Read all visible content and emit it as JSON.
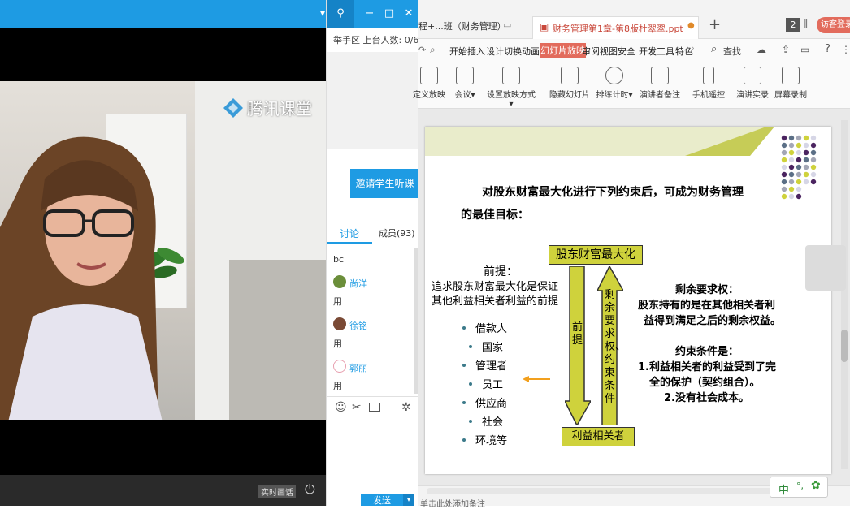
{
  "video": {
    "watermark": "腾讯课堂",
    "footer_label": "实时画话"
  },
  "side": {
    "hand_raise": "举手区 上台人数: 0/6",
    "invite_button": "邀请学生听课",
    "tabs": [
      "讨论",
      "成员(93)"
    ],
    "messages": [
      {
        "user": "",
        "text": "bc"
      },
      {
        "user": "尚洋",
        "text": "用"
      },
      {
        "user": "徐铭",
        "text": "用"
      },
      {
        "user": "郭丽",
        "text": "用"
      }
    ],
    "send_button": "发送"
  },
  "ppt": {
    "tabs": [
      "程+...班（财务管理）",
      "财务管理第1章-第8版杜翠翠.ppt"
    ],
    "tab_badge": "2",
    "login_button": "访客登录",
    "menu": [
      "开始",
      "插入",
      "设计",
      "切换",
      "动画",
      "幻灯片放映",
      "审阅",
      "视图",
      "安全",
      "开发工具",
      "特色"
    ],
    "search": "查找",
    "ribbon": [
      "定义放映",
      "会议",
      "设置放映方式",
      "隐藏幻灯片",
      "排练计时",
      "演讲者备注",
      "手机遥控",
      "演讲实录",
      "屏幕录制"
    ],
    "status_text": "单击此处添加备注",
    "ime_label": "中",
    "slide": {
      "title_line1": "对股东财富最大化进行下列约束后，可成为财务管理",
      "title_line2": "的最佳目标：",
      "top_box": "股东财富最大化",
      "bottom_box": "利益相关者",
      "left_arrow_text": "前提",
      "right_arrow_text": "剩余要求权、约束条件",
      "premise_title": "前提：",
      "premise_text1": "追求股东财富最大化是保证",
      "premise_text2": "其他利益相关者利益的前提",
      "stakeholders": [
        "借款人",
        "国家",
        "管理者",
        "员工",
        "供应商",
        "社会",
        "环境等"
      ],
      "residual_title": "剩余要求权：",
      "residual_text1": "股东持有的是在其他相关者利",
      "residual_text2": "益得到满足之后的剩余权益。",
      "constraint_title": "约束条件是：",
      "constraint_1a": "1.利益相关者的利益受到了完",
      "constraint_1b": "全的保护（契约组合）。",
      "constraint_2": "2.没有社会成本。"
    }
  }
}
